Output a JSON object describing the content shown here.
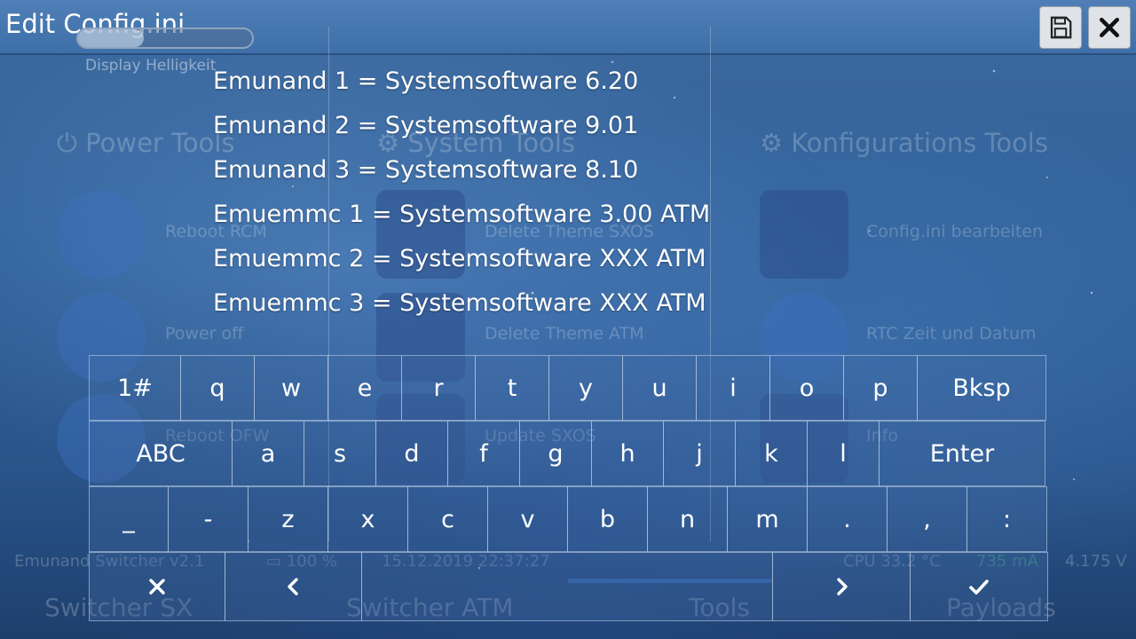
{
  "window": {
    "title": "Edit Config.ini"
  },
  "brightness": {
    "label": "Display Helligkeit",
    "level": 0.38
  },
  "toolbar": {
    "save_icon": "floppy-disk-icon",
    "close_icon": "close-icon"
  },
  "background_app": {
    "sections": [
      {
        "title": "Power Tools",
        "icon": "power-icon"
      },
      {
        "title": "System Tools",
        "icon": "gear-icon"
      },
      {
        "title": "Konfigurations Tools",
        "icon": "gear-icon"
      }
    ],
    "items": [
      "Reboot RCM",
      "Power off",
      "Reboot OFW",
      "Delete Theme SXOS",
      "Delete Theme ATM",
      "Update SXOS",
      "Config.ini bearbeiten",
      "RTC Zeit und Datum",
      "Info"
    ],
    "status": {
      "app": "Emunand Switcher v2.1",
      "battery": "100 %",
      "datetime": "15.12.2019  22:37:27",
      "cpu": "CPU 33.2 °C",
      "current": "735 mA",
      "voltage": "4.175 V"
    },
    "tabs": [
      "Switcher SX",
      "Switcher ATM",
      "Tools",
      "Payloads"
    ]
  },
  "config_lines": [
    "Emunand 1 = Systemsoftware 6.20",
    "Emunand 2 = Systemsoftware 9.01",
    "Emunand 3 = Systemsoftware 8.10",
    "Emuemmc 1 = Systemsoftware 3.00 ATM",
    "Emuemmc 2 = Systemsoftware XXX ATM",
    "Emuemmc 3 = Systemsoftware XXX ATM"
  ],
  "keyboard": {
    "row1": [
      "1#",
      "q",
      "w",
      "e",
      "r",
      "t",
      "y",
      "u",
      "i",
      "o",
      "p",
      "Bksp"
    ],
    "row2": [
      "ABC",
      "a",
      "s",
      "d",
      "f",
      "g",
      "h",
      "j",
      "k",
      "l",
      "Enter"
    ],
    "row3": [
      "_",
      "-",
      "z",
      "x",
      "c",
      "v",
      "b",
      "n",
      "m",
      ".",
      ",",
      ":"
    ],
    "row4_icons": [
      "cancel-icon",
      "arrow-left-icon",
      "space-key",
      "arrow-right-icon",
      "confirm-check-icon"
    ]
  }
}
